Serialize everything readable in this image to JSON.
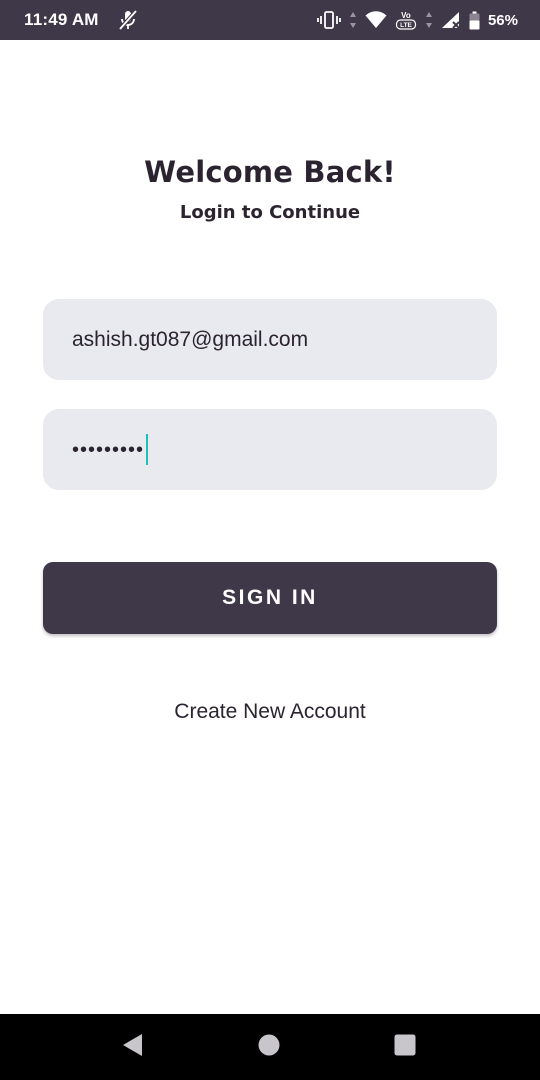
{
  "status_bar": {
    "time": "11:49 AM",
    "battery_percent": "56%",
    "icons": [
      "muted-mic-icon",
      "vibrate-icon",
      "data-arrows-icon",
      "wifi-icon",
      "volte-icon",
      "signal-icon",
      "battery-icon"
    ]
  },
  "header": {
    "title": "Welcome Back!",
    "subtitle": "Login to Continue"
  },
  "form": {
    "email_value": "ashish.gt087@gmail.com",
    "password_mask": "•••••••••",
    "signin_label": "SIGN IN"
  },
  "links": {
    "create_account": "Create New Account"
  },
  "nav_bar": {
    "icons": [
      "back-icon",
      "home-icon",
      "recents-icon"
    ]
  },
  "colors": {
    "primary": "#3f3848",
    "field_bg": "#e9eaef",
    "caret": "#1fbfb8",
    "text": "#2b2430"
  }
}
